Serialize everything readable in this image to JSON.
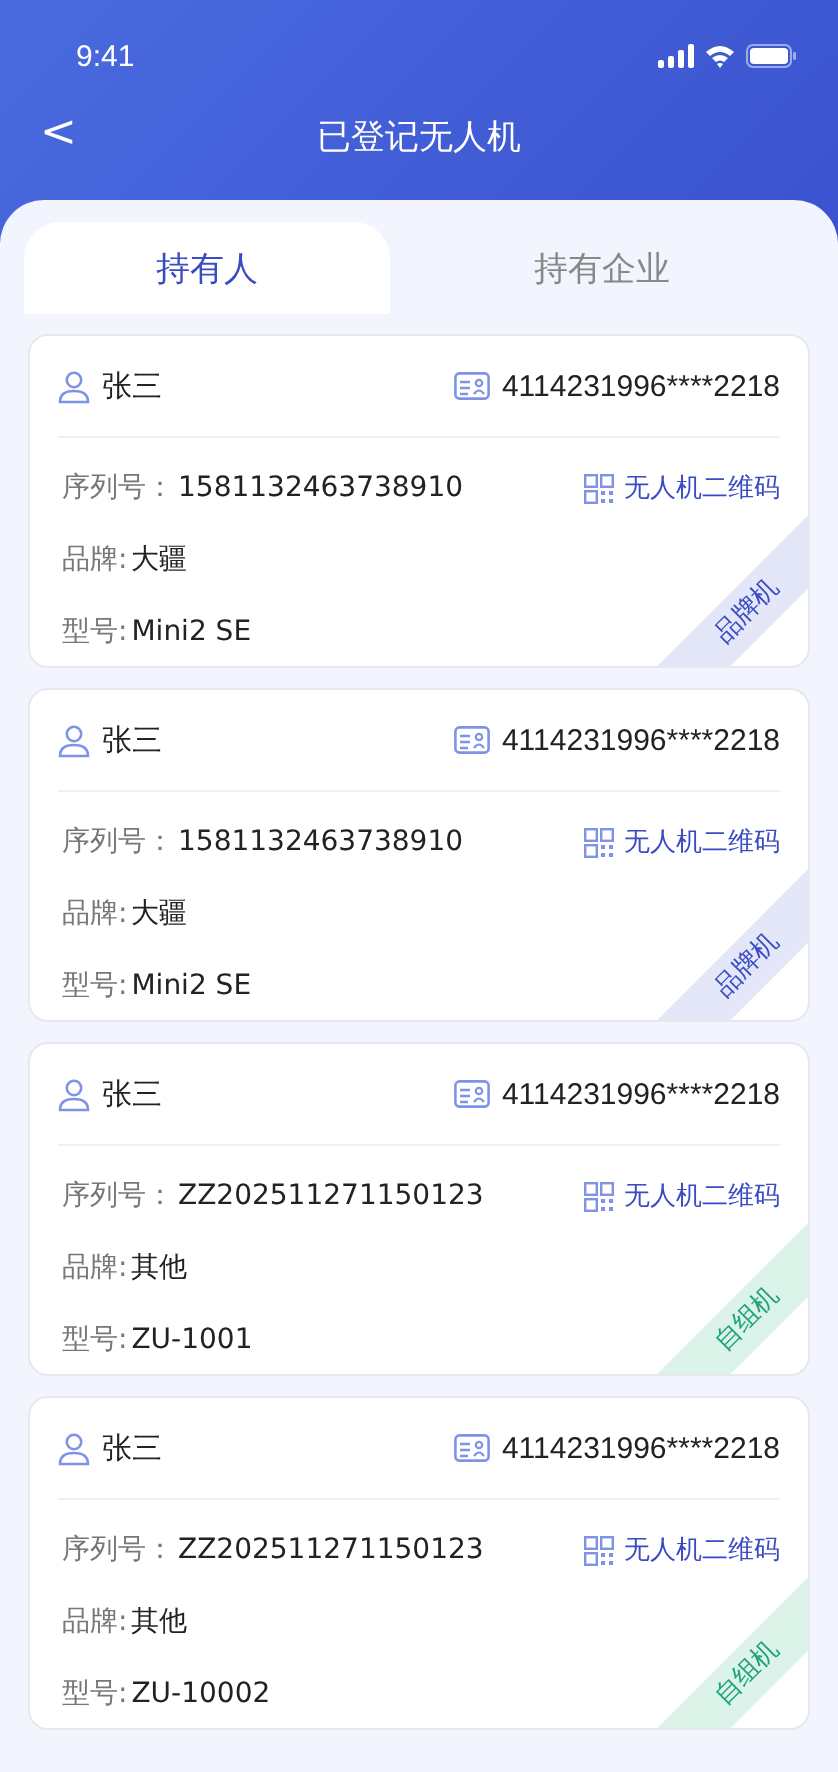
{
  "status_bar": {
    "time": "9:41"
  },
  "nav": {
    "back": "<",
    "title": "已登记无人机"
  },
  "tabs": [
    {
      "label": "持有人",
      "selected": true
    },
    {
      "label": "持有企业",
      "selected": false
    }
  ],
  "cards": [
    {
      "owner": "张三",
      "id_number": "4114231996****2218",
      "serial_label": "序列号：",
      "serial": "1581132463738910",
      "qr_link": "无人机二维码",
      "brand_label": "品牌:",
      "brand": "大疆",
      "model_label": "型号:",
      "model": "Mini2 SE",
      "tag": {
        "kind": "brand",
        "label": "品牌机"
      }
    },
    {
      "owner": "张三",
      "id_number": "4114231996****2218",
      "serial_label": "序列号：",
      "serial": "1581132463738910",
      "qr_link": "无人机二维码",
      "brand_label": "品牌:",
      "brand": "大疆",
      "model_label": "型号:",
      "model": "Mini2 SE",
      "tag": {
        "kind": "brand",
        "label": "品牌机"
      }
    },
    {
      "owner": "张三",
      "id_number": "4114231996****2218",
      "serial_label": "序列号：",
      "serial": "ZZ202511271150123",
      "qr_link": "无人机二维码",
      "brand_label": "品牌:",
      "brand": "其他",
      "model_label": "型号:",
      "model": "ZU-1001",
      "tag": {
        "kind": "custom",
        "label": "自组机"
      }
    },
    {
      "owner": "张三",
      "id_number": "4114231996****2218",
      "serial_label": "序列号：",
      "serial": "ZZ202511271150123",
      "qr_link": "无人机二维码",
      "brand_label": "品牌:",
      "brand": "其他",
      "model_label": "型号:",
      "model": "ZU-10002",
      "tag": {
        "kind": "custom",
        "label": "自组机"
      }
    }
  ]
}
